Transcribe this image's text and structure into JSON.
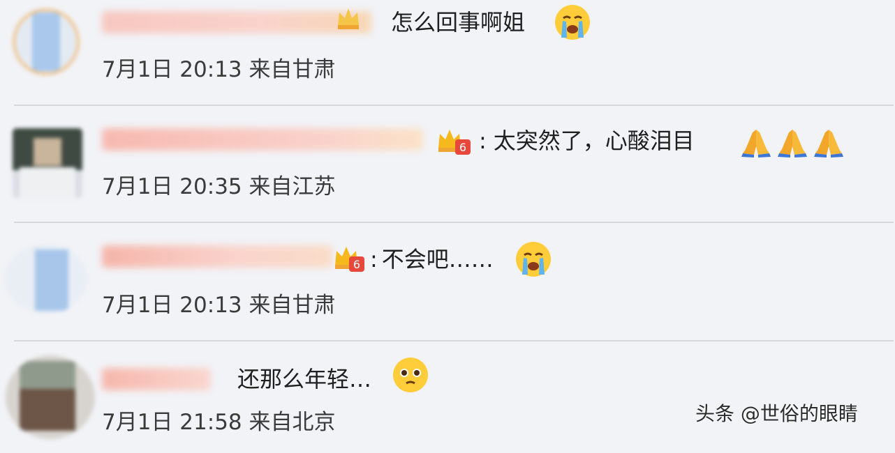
{
  "comments": [
    {
      "text": "怎么回事啊姐",
      "meta": "7月1日 20:13 来自甘肃",
      "emoji": [
        "crying-face"
      ]
    },
    {
      "text": "太突然了，心酸泪目",
      "meta": "7月1日 20:35 来自江苏",
      "emoji": [
        "folded-hands",
        "folded-hands",
        "folded-hands"
      ]
    },
    {
      "text": "不会吧……",
      "meta": "7月1日 20:13 来自甘肃",
      "emoji": [
        "crying-face"
      ]
    },
    {
      "text": "还那么年轻…",
      "meta": "7月1日 21:58 来自北京",
      "emoji": [
        "pleading-face"
      ]
    }
  ],
  "watermark": "头条 @世俗的眼睛",
  "colors": {
    "background": "#f2f3f7",
    "username_blur": "#f4b3a8",
    "vip_gold": "#f5b91e",
    "vip_red": "#e8483c",
    "divider": "#d6d8de"
  }
}
